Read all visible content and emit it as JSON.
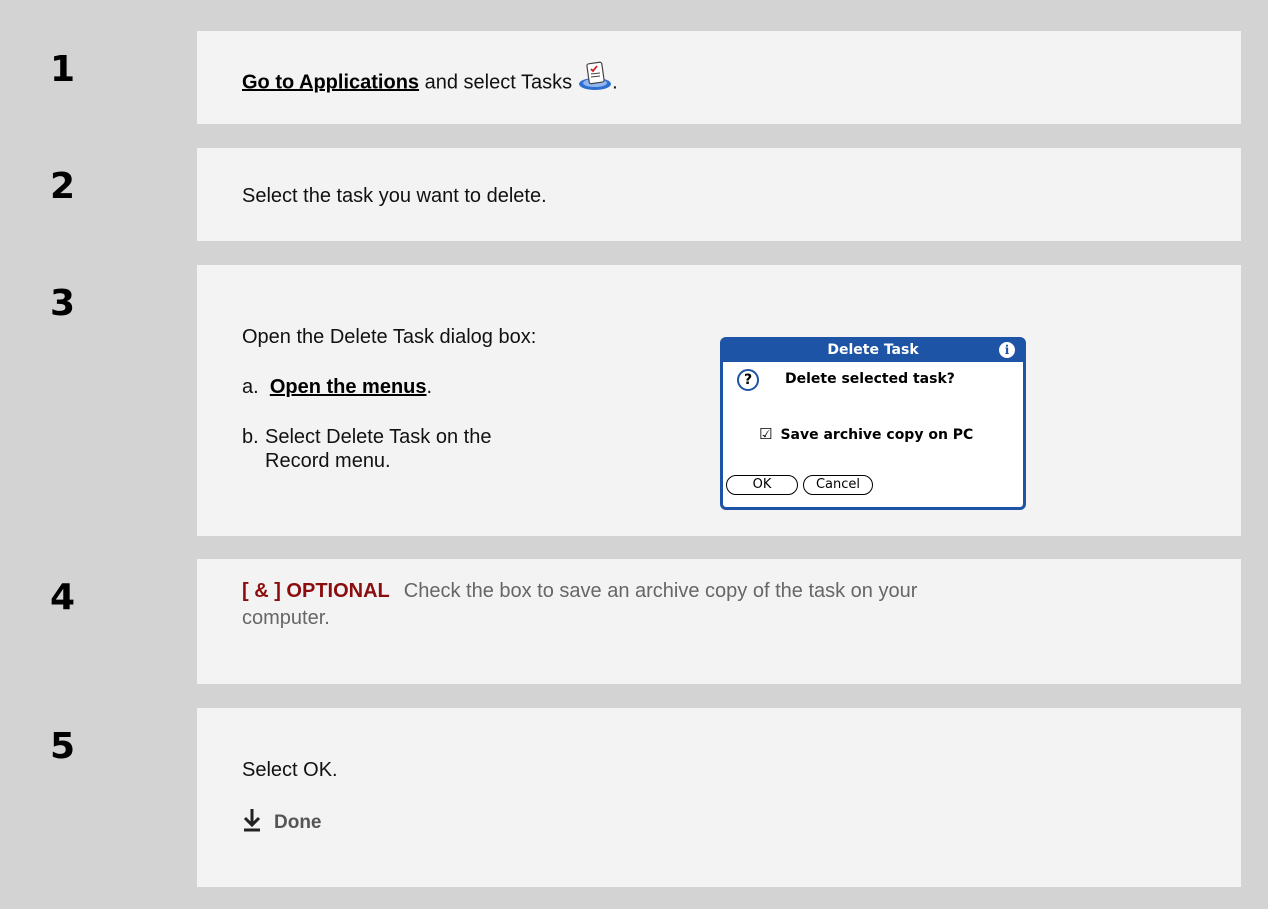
{
  "steps": [
    {
      "number": "1",
      "link": "Go to Applications",
      "text": " and select Tasks",
      "after_icon": "."
    },
    {
      "number": "2",
      "text": "Select the task you want to delete."
    },
    {
      "number": "3",
      "intro": "Open the Delete Task dialog box:",
      "a_prefix": "a.",
      "a_link": "Open the menus",
      "a_suffix": ".",
      "b_prefix": "b.",
      "b_line1": "Select Delete Task on the",
      "b_line2": "Record menu."
    },
    {
      "number": "4",
      "optional_label": "[ & ]  OPTIONAL",
      "text_line1": "Check the box to save an archive copy of the task on your",
      "text_line2": "computer."
    },
    {
      "number": "5",
      "text": "Select OK.",
      "done_label": "Done"
    }
  ],
  "dialog": {
    "title": "Delete Task",
    "info_icon": "i",
    "question_icon": "?",
    "message": "Delete selected task?",
    "checkbox_label": "Save archive copy on PC",
    "checkbox_checked": true,
    "ok_label": "OK",
    "cancel_label": "Cancel"
  },
  "colors": {
    "optional": "#8b0d0d",
    "dialog_accent": "#1e54a6"
  }
}
